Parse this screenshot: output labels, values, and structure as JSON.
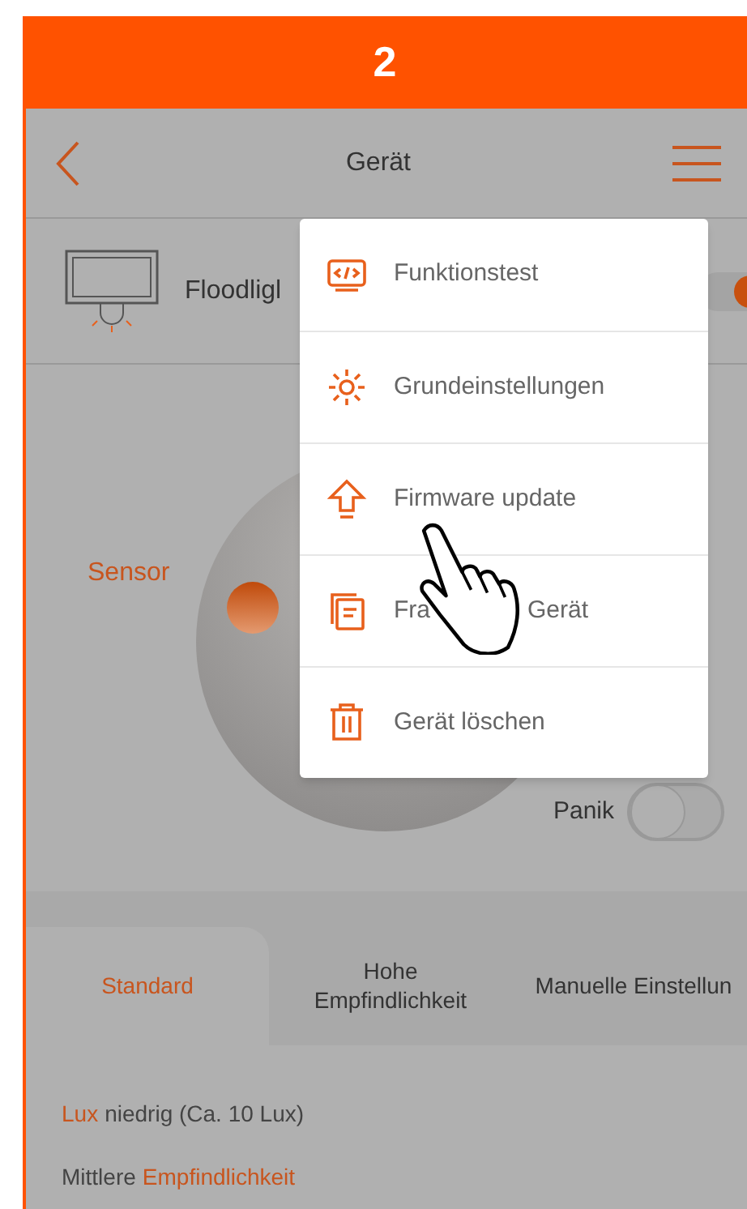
{
  "banner": {
    "step": "2"
  },
  "header": {
    "title": "Gerät"
  },
  "device": {
    "name": "Floodligl",
    "on": true
  },
  "sensor": {
    "label": "Sensor",
    "panic_label": "Panik",
    "panic_on": false
  },
  "tabs": [
    {
      "label": "Standard",
      "selected": true
    },
    {
      "label": "Hohe Empfindlichkeit",
      "selected": false
    },
    {
      "label": "Manuelle Einstellun",
      "selected": false
    }
  ],
  "settings": [
    {
      "parts": [
        {
          "text": "Lux",
          "accent": true
        },
        {
          "text": "niedrig (Ca. 10 Lux)",
          "accent": false
        }
      ]
    },
    {
      "parts": [
        {
          "text": "Mittlere",
          "accent": false
        },
        {
          "text": "Empfindlichkeit",
          "accent": true
        }
      ]
    }
  ],
  "menu": [
    {
      "kind": "code",
      "parts": [
        "Funktionstest"
      ]
    },
    {
      "kind": "gear",
      "parts": [
        "Grundeinstellungen"
      ]
    },
    {
      "kind": "upload",
      "parts": [
        "Firmware update"
      ]
    },
    {
      "kind": "document",
      "parts": [
        "Fra",
        "Gerät"
      ]
    },
    {
      "kind": "trash",
      "parts": [
        "Gerät löschen"
      ]
    }
  ]
}
